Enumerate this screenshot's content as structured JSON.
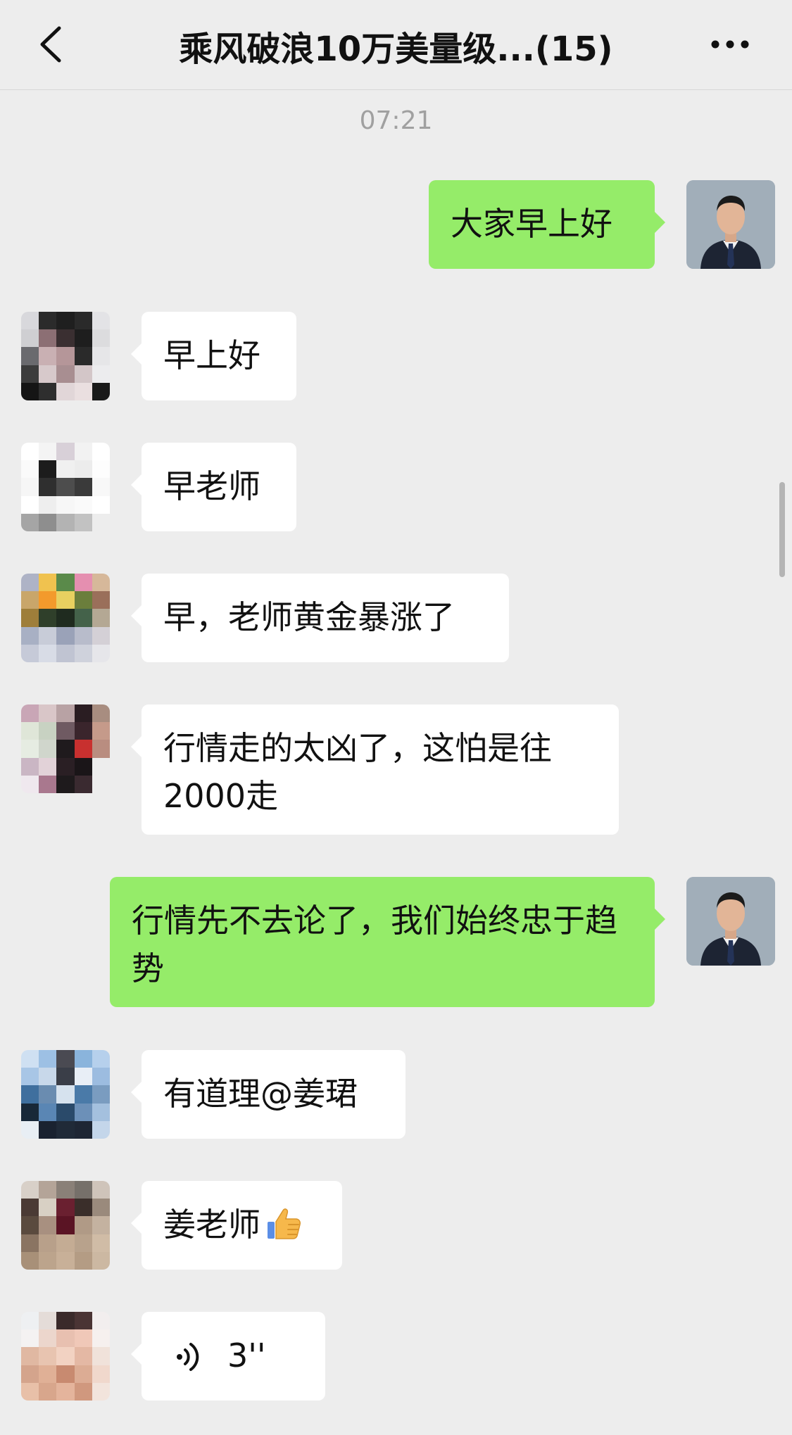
{
  "header": {
    "title": "乘风破浪10万美量级...(15)",
    "back_icon": "chevron-left-icon",
    "more_icon": "ellipsis-icon"
  },
  "timestamp": "07:21",
  "messages": [
    {
      "direction": "out",
      "text": "大家早上好"
    },
    {
      "direction": "in",
      "text": "早上好"
    },
    {
      "direction": "in",
      "text": "早老师"
    },
    {
      "direction": "in",
      "text": "早，老师黄金暴涨了"
    },
    {
      "direction": "in",
      "text": "行情走的太凶了，这怕是往2000走"
    },
    {
      "direction": "out",
      "text": "行情先不去论了，我们始终忠于趋势"
    },
    {
      "direction": "in",
      "text": "有道理@姜珺"
    },
    {
      "direction": "in",
      "text": "姜老师",
      "emoji": "thumbs-up-icon"
    },
    {
      "direction": "in",
      "type": "voice",
      "duration": "3''",
      "icon": "voice-wave-icon"
    }
  ],
  "colors": {
    "background": "#ededed",
    "outgoing_bubble": "#95ec69",
    "incoming_bubble": "#ffffff"
  }
}
